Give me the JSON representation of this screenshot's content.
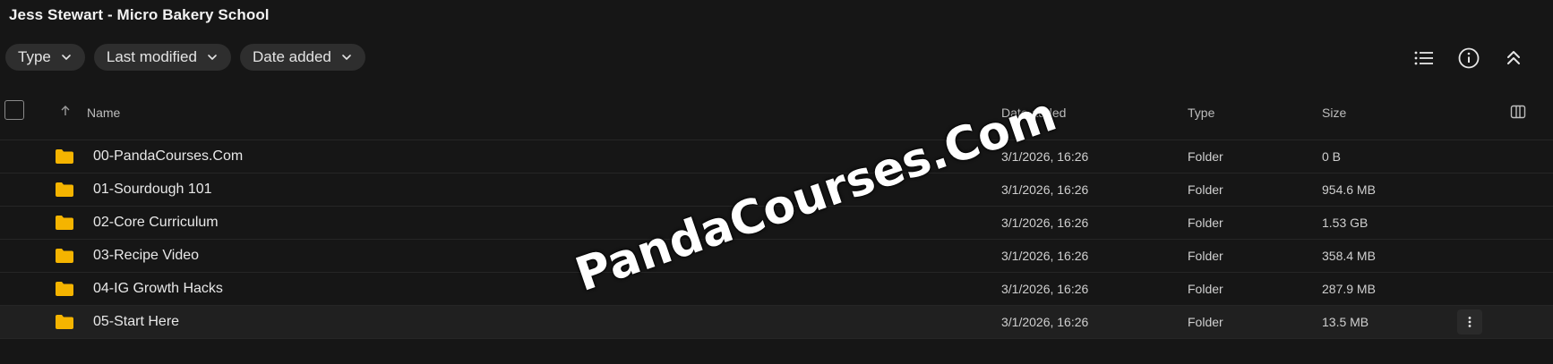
{
  "window": {
    "title": "Jess Stewart - Micro Bakery School"
  },
  "filters": [
    {
      "label": "Type"
    },
    {
      "label": "Last modified"
    },
    {
      "label": "Date added"
    }
  ],
  "toolbar": {
    "icons": [
      "list-view-icon",
      "info-icon",
      "collapse-icon"
    ]
  },
  "table": {
    "columns": {
      "name": "Name",
      "date_added": "Date added",
      "type": "Type",
      "size": "Size"
    },
    "rows": [
      {
        "name": "00-PandaCourses.Com",
        "date_added": "3/1/2026, 16:26",
        "type": "Folder",
        "size": "0 B"
      },
      {
        "name": "01-Sourdough 101",
        "date_added": "3/1/2026, 16:26",
        "type": "Folder",
        "size": "954.6 MB"
      },
      {
        "name": "02-Core Curriculum",
        "date_added": "3/1/2026, 16:26",
        "type": "Folder",
        "size": "1.53 GB"
      },
      {
        "name": "03-Recipe Video",
        "date_added": "3/1/2026, 16:26",
        "type": "Folder",
        "size": "358.4 MB"
      },
      {
        "name": "04-IG Growth Hacks",
        "date_added": "3/1/2026, 16:26",
        "type": "Folder",
        "size": "287.9 MB"
      },
      {
        "name": "05-Start Here",
        "date_added": "3/1/2026, 16:26",
        "type": "Folder",
        "size": "13.5 MB"
      }
    ]
  },
  "watermark": {
    "text": "PandaCourses.Com"
  },
  "colors": {
    "background": "#161616",
    "folder": "#f5b400",
    "chip": "#2e2e2e",
    "highlight_row": "#202020"
  }
}
